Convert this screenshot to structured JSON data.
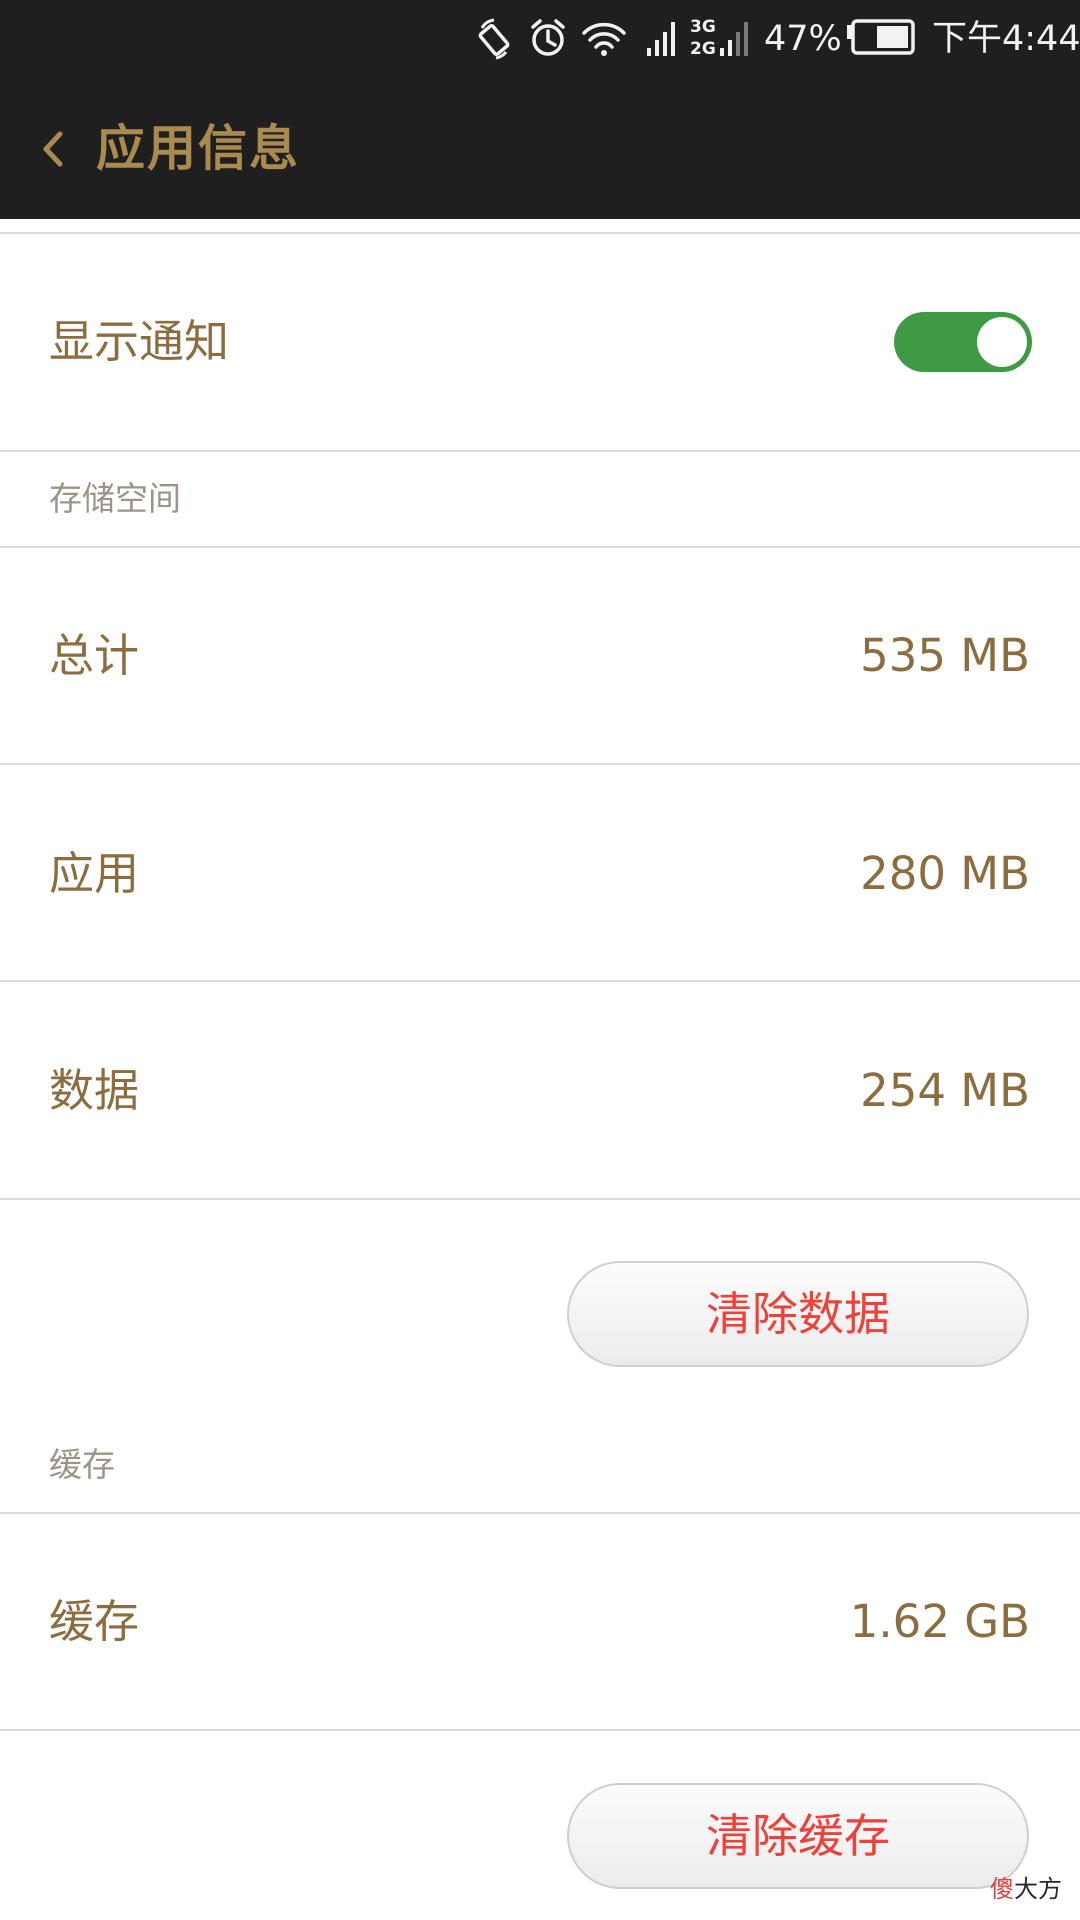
{
  "status_bar": {
    "battery_percent": "47%",
    "time": "下午4:44",
    "network_top": "3G",
    "network_bottom": "2G",
    "icons": [
      "rotate-icon",
      "alarm-icon",
      "wifi-icon",
      "signal-icon",
      "dual-sim-signal-icon",
      "battery-icon"
    ]
  },
  "header": {
    "title": "应用信息",
    "back_icon": "chevron-left-icon"
  },
  "notification": {
    "label": "显示通知",
    "toggle_on": true
  },
  "storage": {
    "section_title": "存储空间",
    "rows": [
      {
        "label": "总计",
        "value": "535 MB"
      },
      {
        "label": "应用",
        "value": "280 MB"
      },
      {
        "label": "数据",
        "value": "254 MB"
      }
    ],
    "clear_button": "清除数据"
  },
  "cache": {
    "section_title": "缓存",
    "row": {
      "label": "缓存",
      "value": "1.62 GB"
    },
    "clear_button": "清除缓存"
  },
  "watermark": {
    "part1": "傻",
    "part2": "大方"
  },
  "colors": {
    "bar_background": "#1f1f1f",
    "text_gold": "#8c6d3f",
    "title_gold": "#a98a4f",
    "toggle_green": "#3e9a44",
    "button_text_red": "#f0403a",
    "section_grey": "#9d9488"
  }
}
